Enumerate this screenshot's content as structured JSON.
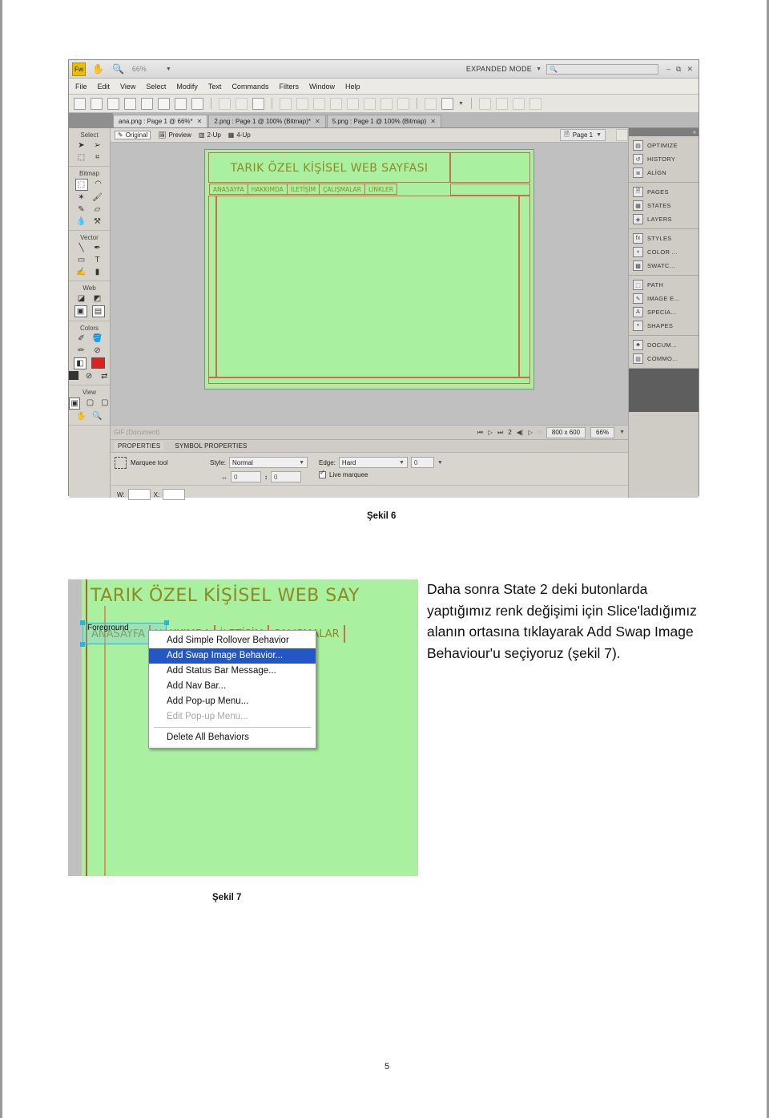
{
  "document": {
    "page_number": "5",
    "figure6_caption": "Şekil 6",
    "figure7_caption": "Şekil 7",
    "body_text": "Daha sonra State 2 deki butonlarda yaptığımız renk değişimi için Slice'ladığımız alanın ortasına tıklayarak Add Swap Image Behaviour'u seçiyoruz (şekil 7)."
  },
  "fireworks": {
    "logo": "Fw",
    "zoom_level": "66%",
    "mode_label": "EXPANDED MODE",
    "search_placeholder": "",
    "window_controls": [
      "–",
      "⧉",
      "✕"
    ],
    "menu": [
      "File",
      "Edit",
      "View",
      "Select",
      "Modify",
      "Text",
      "Commands",
      "Filters",
      "Window",
      "Help"
    ],
    "tabs": [
      {
        "label": "ana.png : Page 1 @ 66%*",
        "active": true
      },
      {
        "label": "2.png : Page 1 @ 100% (Bitmap)*",
        "active": false
      },
      {
        "label": "5.png : Page 1 @ 100% (Bitmap)",
        "active": false
      }
    ],
    "view_modes": [
      "Original",
      "Preview",
      "2-Up",
      "4-Up"
    ],
    "page_selector": "Page 1",
    "toolbox": {
      "groups": [
        {
          "title": "Select",
          "tools": [
            "pointer",
            "subselect",
            "scale",
            "crop"
          ]
        },
        {
          "title": "Bitmap",
          "tools": [
            "marquee",
            "lasso",
            "magic-wand",
            "brush",
            "pencil",
            "eraser",
            "blur",
            "rubber-stamp"
          ]
        },
        {
          "title": "Vector",
          "tools": [
            "line",
            "pen",
            "rectangle",
            "text",
            "freeform",
            "knife"
          ]
        },
        {
          "title": "Web",
          "tools": [
            "slice",
            "polygon-slice",
            "hide-slices",
            "show-slices"
          ]
        },
        {
          "title": "Colors",
          "tools": [
            "eyedropper",
            "paint-bucket",
            "stroke",
            "no-stroke",
            "fill",
            "fill-color",
            "default-colors",
            "no-color",
            "swap-colors"
          ]
        },
        {
          "title": "View",
          "tools": [
            "standard-screen",
            "full-screen-menu",
            "full-screen",
            "hand",
            "zoom"
          ]
        }
      ]
    },
    "canvas": {
      "site_title": "TARIK ÖZEL KİŞİSEL WEB SAYFASI",
      "nav_items": [
        "ANASAYFA",
        "HAKKIMDA",
        "İLETİŞİM",
        "ÇALIŞMALAR",
        "LİNKLER"
      ],
      "bg_color": "#a9f0a0",
      "slice_color": "#d06a4a",
      "text_color": "#8f8a20"
    },
    "status_bar": {
      "doc_type": "GIF (Document)",
      "state_number": "2",
      "dimensions": "800 x 600",
      "zoom": "66%"
    },
    "properties": {
      "tabs": [
        "PROPERTIES",
        "SYMBOL PROPERTIES"
      ],
      "tool_name": "Marquee tool",
      "style_label": "Style:",
      "style_value": "Normal",
      "edge_label": "Edge:",
      "edge_value": "Hard",
      "edge_amount": "0",
      "width_value": "0",
      "height_value": "0",
      "live_marquee_label": "Live marquee",
      "w_label": "W:",
      "x_label": "X:",
      "w_value": "",
      "x_value": ""
    },
    "panels": [
      {
        "items": [
          {
            "label": "OPTIMIZE",
            "icon": "monitor-icon"
          },
          {
            "label": "HISTORY",
            "icon": "history-icon"
          },
          {
            "label": "ALİGN",
            "icon": "align-icon"
          }
        ]
      },
      {
        "items": [
          {
            "label": "PAGES",
            "icon": "page-icon"
          },
          {
            "label": "STATES",
            "icon": "states-icon"
          },
          {
            "label": "LAYERS",
            "icon": "layers-icon"
          }
        ]
      },
      {
        "items": [
          {
            "label": "STYLES",
            "icon": "styles-icon"
          },
          {
            "label": "COLOR ...",
            "icon": "color-icon"
          },
          {
            "label": "SWATC...",
            "icon": "swatches-icon"
          }
        ]
      },
      {
        "items": [
          {
            "label": "PATH",
            "icon": "path-icon"
          },
          {
            "label": "IMAGE E...",
            "icon": "image-editing-icon"
          },
          {
            "label": "SPECİA...",
            "icon": "special-icon"
          },
          {
            "label": "SHAPES",
            "icon": "shapes-icon"
          }
        ]
      },
      {
        "items": [
          {
            "label": "DOCUM...",
            "icon": "document-icon"
          },
          {
            "label": "COMMO...",
            "icon": "common-icon"
          }
        ]
      }
    ]
  },
  "figure7": {
    "site_title": "TARIK ÖZEL KİŞİSEL WEB SAY",
    "nav_items": [
      "ANASAYFA",
      "HAKKIMDA",
      "İLETİŞİM",
      "ÇALIŞMALAR"
    ],
    "tooltip": "Foreground",
    "context_menu": [
      {
        "label": "Add Simple Rollover Behavior",
        "state": "normal"
      },
      {
        "label": "Add Swap Image Behavior...",
        "state": "selected"
      },
      {
        "label": "Add Status Bar Message...",
        "state": "normal"
      },
      {
        "label": "Add Nav Bar...",
        "state": "normal"
      },
      {
        "label": "Add Pop-up Menu...",
        "state": "normal"
      },
      {
        "label": "Edit Pop-up Menu...",
        "state": "disabled"
      },
      {
        "label": "Delete All Behaviors",
        "state": "normal"
      }
    ]
  }
}
